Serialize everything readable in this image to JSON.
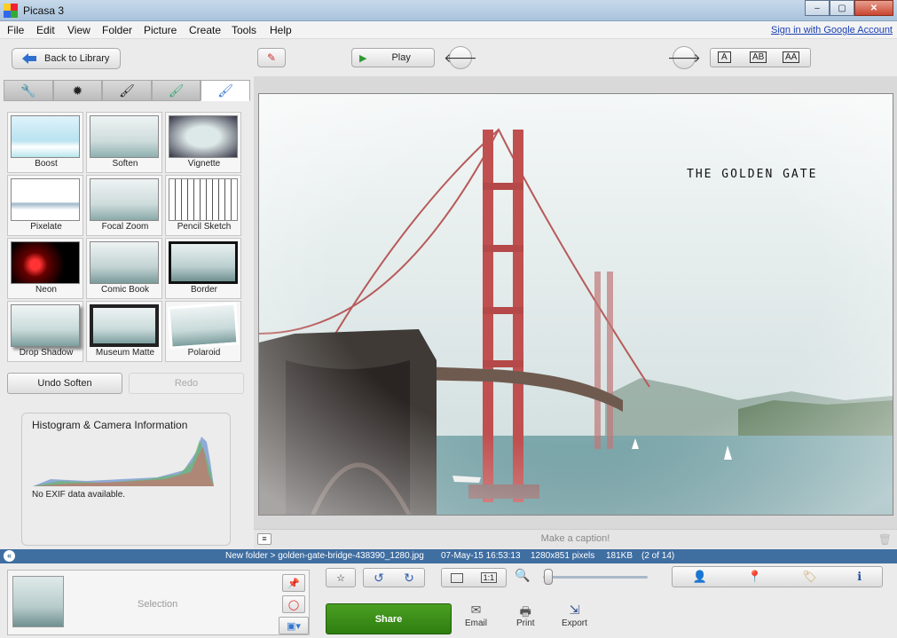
{
  "window": {
    "title": "Picasa 3",
    "min_glyph": "–",
    "max_glyph": "▢",
    "close_glyph": "✕"
  },
  "menu": {
    "items": [
      "File",
      "Edit",
      "View",
      "Folder",
      "Picture",
      "Create",
      "Tools",
      "Help"
    ],
    "sign_in": "Sign in with Google Account"
  },
  "toolbar": {
    "back_label": "Back to Library",
    "play_label": "Play",
    "caption_modes": [
      "A",
      "AB",
      "AA"
    ]
  },
  "effects": {
    "items": [
      {
        "label": "Boost"
      },
      {
        "label": "Soften"
      },
      {
        "label": "Vignette"
      },
      {
        "label": "Pixelate"
      },
      {
        "label": "Focal Zoom"
      },
      {
        "label": "Pencil Sketch"
      },
      {
        "label": "Neon"
      },
      {
        "label": "Comic Book"
      },
      {
        "label": "Border"
      },
      {
        "label": "Drop Shadow"
      },
      {
        "label": "Museum Matte"
      },
      {
        "label": "Polaroid"
      }
    ],
    "undo_label": "Undo Soften",
    "redo_label": "Redo"
  },
  "histogram": {
    "title": "Histogram & Camera Information",
    "note": "No EXIF data available."
  },
  "photo": {
    "overlay_text": "THE GOLDEN GATE",
    "caption_placeholder": "Make a caption!"
  },
  "status": {
    "path": "New folder > golden-gate-bridge-438390_1280.jpg",
    "date": "07-May-15 16:53:13",
    "dimensions": "1280x851 pixels",
    "size": "181KB",
    "position": "(2 of 14)"
  },
  "bottom": {
    "selection_label": "Selection",
    "share_label": "Share",
    "email_label": "Email",
    "print_label": "Print",
    "export_label": "Export",
    "fit_label": "1:1"
  },
  "colors": {
    "status_bar": "#3f6ea1",
    "share_button": "#3e8e1e",
    "link": "#1a3fb5"
  }
}
